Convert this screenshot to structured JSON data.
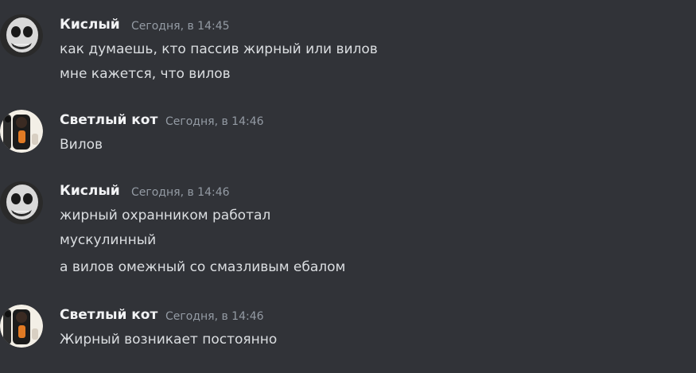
{
  "messages": [
    {
      "author": "Кислый",
      "timestamp": "Сегодня, в 14:45",
      "avatar": "skull-face-icon",
      "lines": [
        "как думаешь, кто пассив жирный или вилов",
        "мне кажется, что вилов"
      ]
    },
    {
      "author": "Светлый кот",
      "timestamp": "Сегодня, в 14:46",
      "avatar": "cat-figure-icon",
      "lines": [
        "Вилов"
      ]
    },
    {
      "author": "Кислый",
      "timestamp": "Сегодня, в 14:46",
      "avatar": "skull-face-icon",
      "lines": [
        "жирный охранником работал",
        "мускулинный",
        "а вилов омежный со смазливым ебалом"
      ]
    },
    {
      "author": "Светлый кот",
      "timestamp": "Сегодня, в 14:46",
      "avatar": "cat-figure-icon",
      "lines": [
        "Жирный возникает постоянно"
      ]
    }
  ]
}
